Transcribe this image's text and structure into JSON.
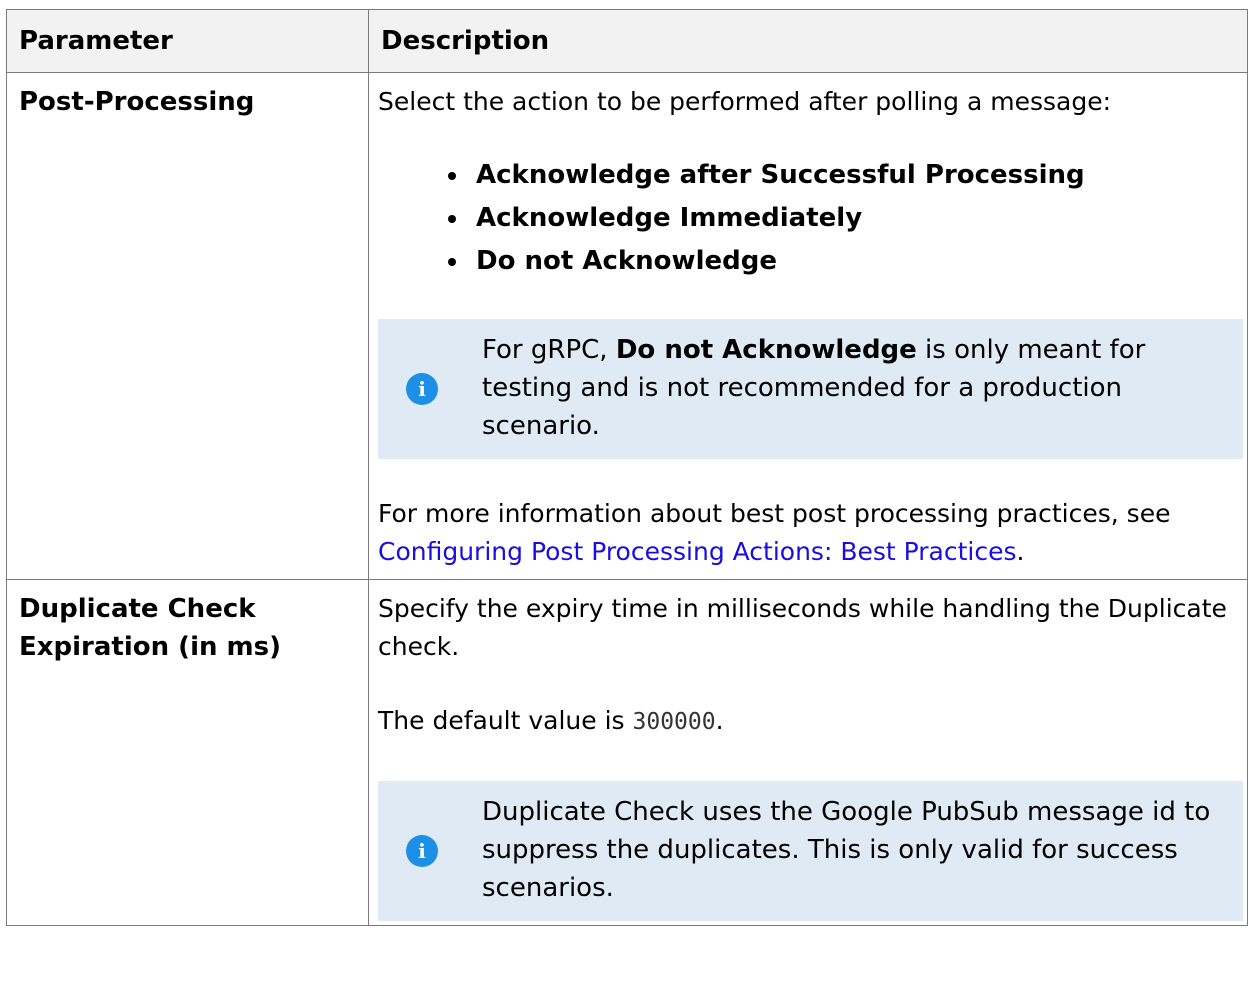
{
  "table": {
    "headers": {
      "parameter": "Parameter",
      "description": "Description"
    },
    "rows": [
      {
        "parameter": "Post-Processing",
        "intro": "Select the action to be performed after polling a message:",
        "options": [
          "Acknowledge after Successful Processing",
          "Acknowledge Immediately",
          "Do not Acknowledge"
        ],
        "note": {
          "icon": "info-icon",
          "prefix": "For gRPC, ",
          "bold": "Do not Acknowledge",
          "suffix": " is only meant for testing and is not recommended for a production scenario."
        },
        "more_prefix": "For more information about best post processing practices, see ",
        "more_link": "Configuring Post Processing Actions: Best Practices",
        "more_suffix": "."
      },
      {
        "parameter": "Duplicate Check Expiration (in ms)",
        "intro": "Specify the expiry time in milliseconds while handling the Duplicate check.",
        "default_prefix": "The default value is ",
        "default_value": "300000",
        "default_suffix": ".",
        "note": {
          "icon": "info-icon",
          "text": "Duplicate Check uses the Google PubSub message id to suppress the duplicates. This is only valid for success scenarios."
        }
      }
    ]
  },
  "colors": {
    "header_bg": "#f2f2f2",
    "note_bg": "#e0eaf5",
    "info_icon": "#1e8fe6",
    "link": "#1a0dde",
    "border": "#7a7a7a"
  }
}
